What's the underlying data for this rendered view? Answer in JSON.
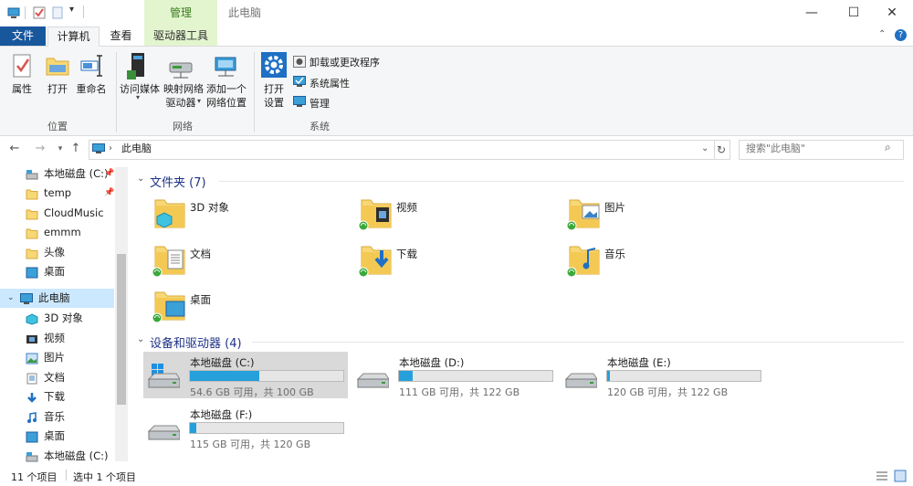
{
  "window": {
    "title": "此电脑",
    "context_tab_header": "管理"
  },
  "tabs": {
    "file": "文件",
    "computer": "计算机",
    "view": "查看",
    "drive_tools": "驱动器工具"
  },
  "ribbon": {
    "location": {
      "label": "位置",
      "properties": "属性",
      "open": "打开",
      "rename": "重命名"
    },
    "network": {
      "label": "网络",
      "access_media_line1": "访问媒体",
      "map_drive_line1": "映射网络",
      "map_drive_line2": "驱动器",
      "add_location_line1": "添加一个",
      "add_location_line2": "网络位置"
    },
    "system": {
      "label": "系统",
      "open_settings_line1": "打开",
      "open_settings_line2": "设置",
      "uninstall": "卸载或更改程序",
      "system_properties": "系统属性",
      "manage": "管理"
    }
  },
  "address": {
    "path": "此电脑",
    "search_placeholder": "搜索\"此电脑\""
  },
  "nav": {
    "quick_access": [
      {
        "label": "本地磁盘 (C:)",
        "pinned": true
      },
      {
        "label": "temp",
        "pinned": true
      },
      {
        "label": "CloudMusic",
        "pinned": false
      },
      {
        "label": "emmm",
        "pinned": false
      },
      {
        "label": "头像",
        "pinned": false
      },
      {
        "label": "桌面",
        "pinned": false
      }
    ],
    "this_pc": "此电脑",
    "this_pc_children": [
      "3D 对象",
      "视频",
      "图片",
      "文档",
      "下载",
      "音乐",
      "桌面",
      "本地磁盘 (C:)"
    ]
  },
  "folders_section": {
    "title": "文件夹 (7)",
    "items": [
      "3D 对象",
      "视频",
      "图片",
      "文档",
      "下载",
      "音乐",
      "桌面"
    ]
  },
  "drives_section": {
    "title": "设备和驱动器 (4)",
    "items": [
      {
        "name": "本地磁盘 (C:)",
        "info": "54.6 GB 可用，共 100 GB",
        "used_fraction": 0.454
      },
      {
        "name": "本地磁盘 (D:)",
        "info": "111 GB 可用，共 122 GB",
        "used_fraction": 0.09
      },
      {
        "name": "本地磁盘 (E:)",
        "info": "120 GB 可用，共 122 GB",
        "used_fraction": 0.016
      },
      {
        "name": "本地磁盘 (F:)",
        "info": "115 GB 可用，共 120 GB",
        "used_fraction": 0.042
      }
    ]
  },
  "status": {
    "item_count": "11 个项目",
    "selected": "选中 1 个项目"
  },
  "colors": {
    "file_tab": "#19579c",
    "context_tab": "#e3f5cf",
    "drive_fill": "#26a0da",
    "folder_yellow": "#f8d775",
    "section_title": "#1e3287"
  }
}
